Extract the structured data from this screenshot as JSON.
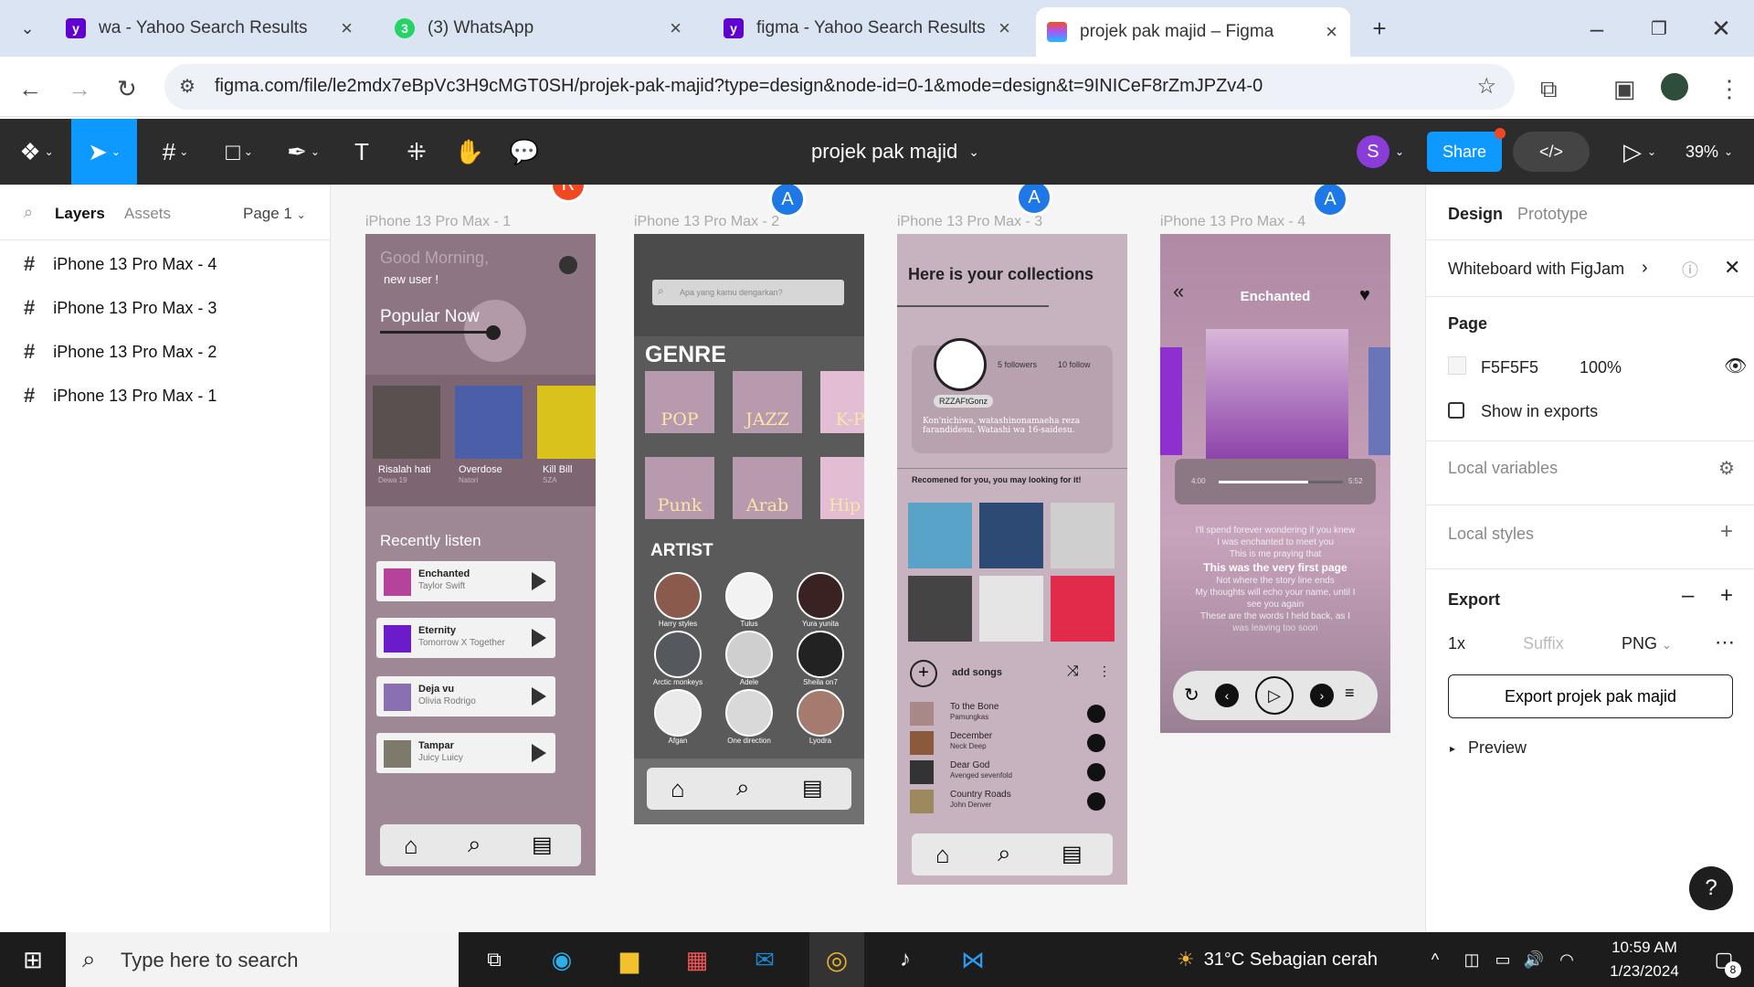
{
  "browser": {
    "tabs": [
      {
        "title": "wa - Yahoo Search Results",
        "icon": "yahoo-icon"
      },
      {
        "title": "(3) WhatsApp",
        "icon": "whatsapp-icon"
      },
      {
        "title": "figma - Yahoo Search Results",
        "icon": "yahoo-icon"
      },
      {
        "title": "projek pak majid – Figma",
        "icon": "figma-icon"
      }
    ],
    "url": "figma.com/file/le2mdx7eBpVc3H9cMGT0SH/projek-pak-majid?type=design&node-id=0-1&mode=design&t=9INICeF8rZmJPZv4-0"
  },
  "figma": {
    "file_name": "projek pak majid",
    "user_initial": "S",
    "share_label": "Share",
    "zoom": "39%",
    "left_tabs": {
      "layers": "Layers",
      "assets": "Assets",
      "page": "Page 1"
    },
    "layers": [
      "iPhone 13 Pro Max - 4",
      "iPhone 13 Pro Max - 3",
      "iPhone 13 Pro Max - 2",
      "iPhone 13 Pro Max - 1"
    ],
    "frames": [
      "iPhone 13 Pro Max - 1",
      "iPhone 13 Pro Max - 2",
      "iPhone 13 Pro Max - 3",
      "iPhone 13 Pro Max - 4"
    ],
    "cursors": [
      "R",
      "A",
      "A",
      "A"
    ],
    "right": {
      "tab_design": "Design",
      "tab_prototype": "Prototype",
      "whiteboard": "Whiteboard with FigJam",
      "page_label": "Page",
      "page_color": "F5F5F5",
      "page_opacity": "100%",
      "show_in_exports": "Show in exports",
      "local_variables": "Local variables",
      "local_styles": "Local styles",
      "export": "Export",
      "scale": "1x",
      "suffix_placeholder": "Suffix",
      "format": "PNG",
      "export_button": "Export projek pak majid",
      "preview": "Preview"
    }
  },
  "screen1": {
    "greeting": "Good Morning,",
    "user": "new user !",
    "popular": "Popular Now",
    "popular_items": [
      {
        "title": "Risalah hati",
        "artist": "Dewa 19"
      },
      {
        "title": "Overdose",
        "artist": "Natori"
      },
      {
        "title": "Kill Bill",
        "artist": "SZA"
      }
    ],
    "recent_title": "Recently listen",
    "recent": [
      {
        "title": "Enchanted",
        "artist": "Taylor Swift"
      },
      {
        "title": "Eternity",
        "artist": "Tomorrow X Together"
      },
      {
        "title": "Deja vu",
        "artist": "Olivia Rodrigo"
      },
      {
        "title": "Tampar",
        "artist": "Juicy Luicy"
      }
    ]
  },
  "screen2": {
    "search_placeholder": "Apa yang kamu dengarkan?",
    "genre_title": "GENRE",
    "genres": [
      "POP",
      "JAZZ",
      "K-Po",
      "Punk",
      "Arab",
      "Hip H"
    ],
    "artist_title": "ARTIST",
    "artists": [
      "Harry styles",
      "Tulus",
      "Yura yunita",
      "Arctic monkeys",
      "Adele",
      "Sheila on7",
      "Afgan",
      "One direction",
      "Lyodra"
    ]
  },
  "screen3": {
    "title": "Here is your collections",
    "followers": "5 followers",
    "follow": "10 follow",
    "username": "RZZAFtGonz",
    "bio": "Kon'nichiwa, watashinonamaeha reza farandidesu. Watashi wa 16-saidesu.",
    "recommend": "Recomened for you, you may looking for it!",
    "add_songs": "add songs",
    "songs": [
      {
        "title": "To the Bone",
        "artist": "Pamungkas"
      },
      {
        "title": "December",
        "artist": "Neck Deep"
      },
      {
        "title": "Dear God",
        "artist": "Avenged sevenfold"
      },
      {
        "title": "Country Roads",
        "artist": "John Denver"
      }
    ]
  },
  "screen4": {
    "title": "Enchanted",
    "time_start": "4:00",
    "time_end": "5:52",
    "progress": 0.72,
    "lyrics": [
      "I'll spend forever wondering if you knew",
      "I was enchanted to meet you",
      "This is me praying that",
      "This was the very first page",
      "Not where the story line ends",
      "My thoughts will echo your name, until I",
      "see you again",
      "These are the words I held back, as I",
      "was leaving too soon"
    ]
  },
  "taskbar": {
    "search_placeholder": "Type here to search",
    "weather": "31°C  Sebagian cerah",
    "time": "10:59 AM",
    "date": "1/23/2024",
    "notifications": "8"
  }
}
